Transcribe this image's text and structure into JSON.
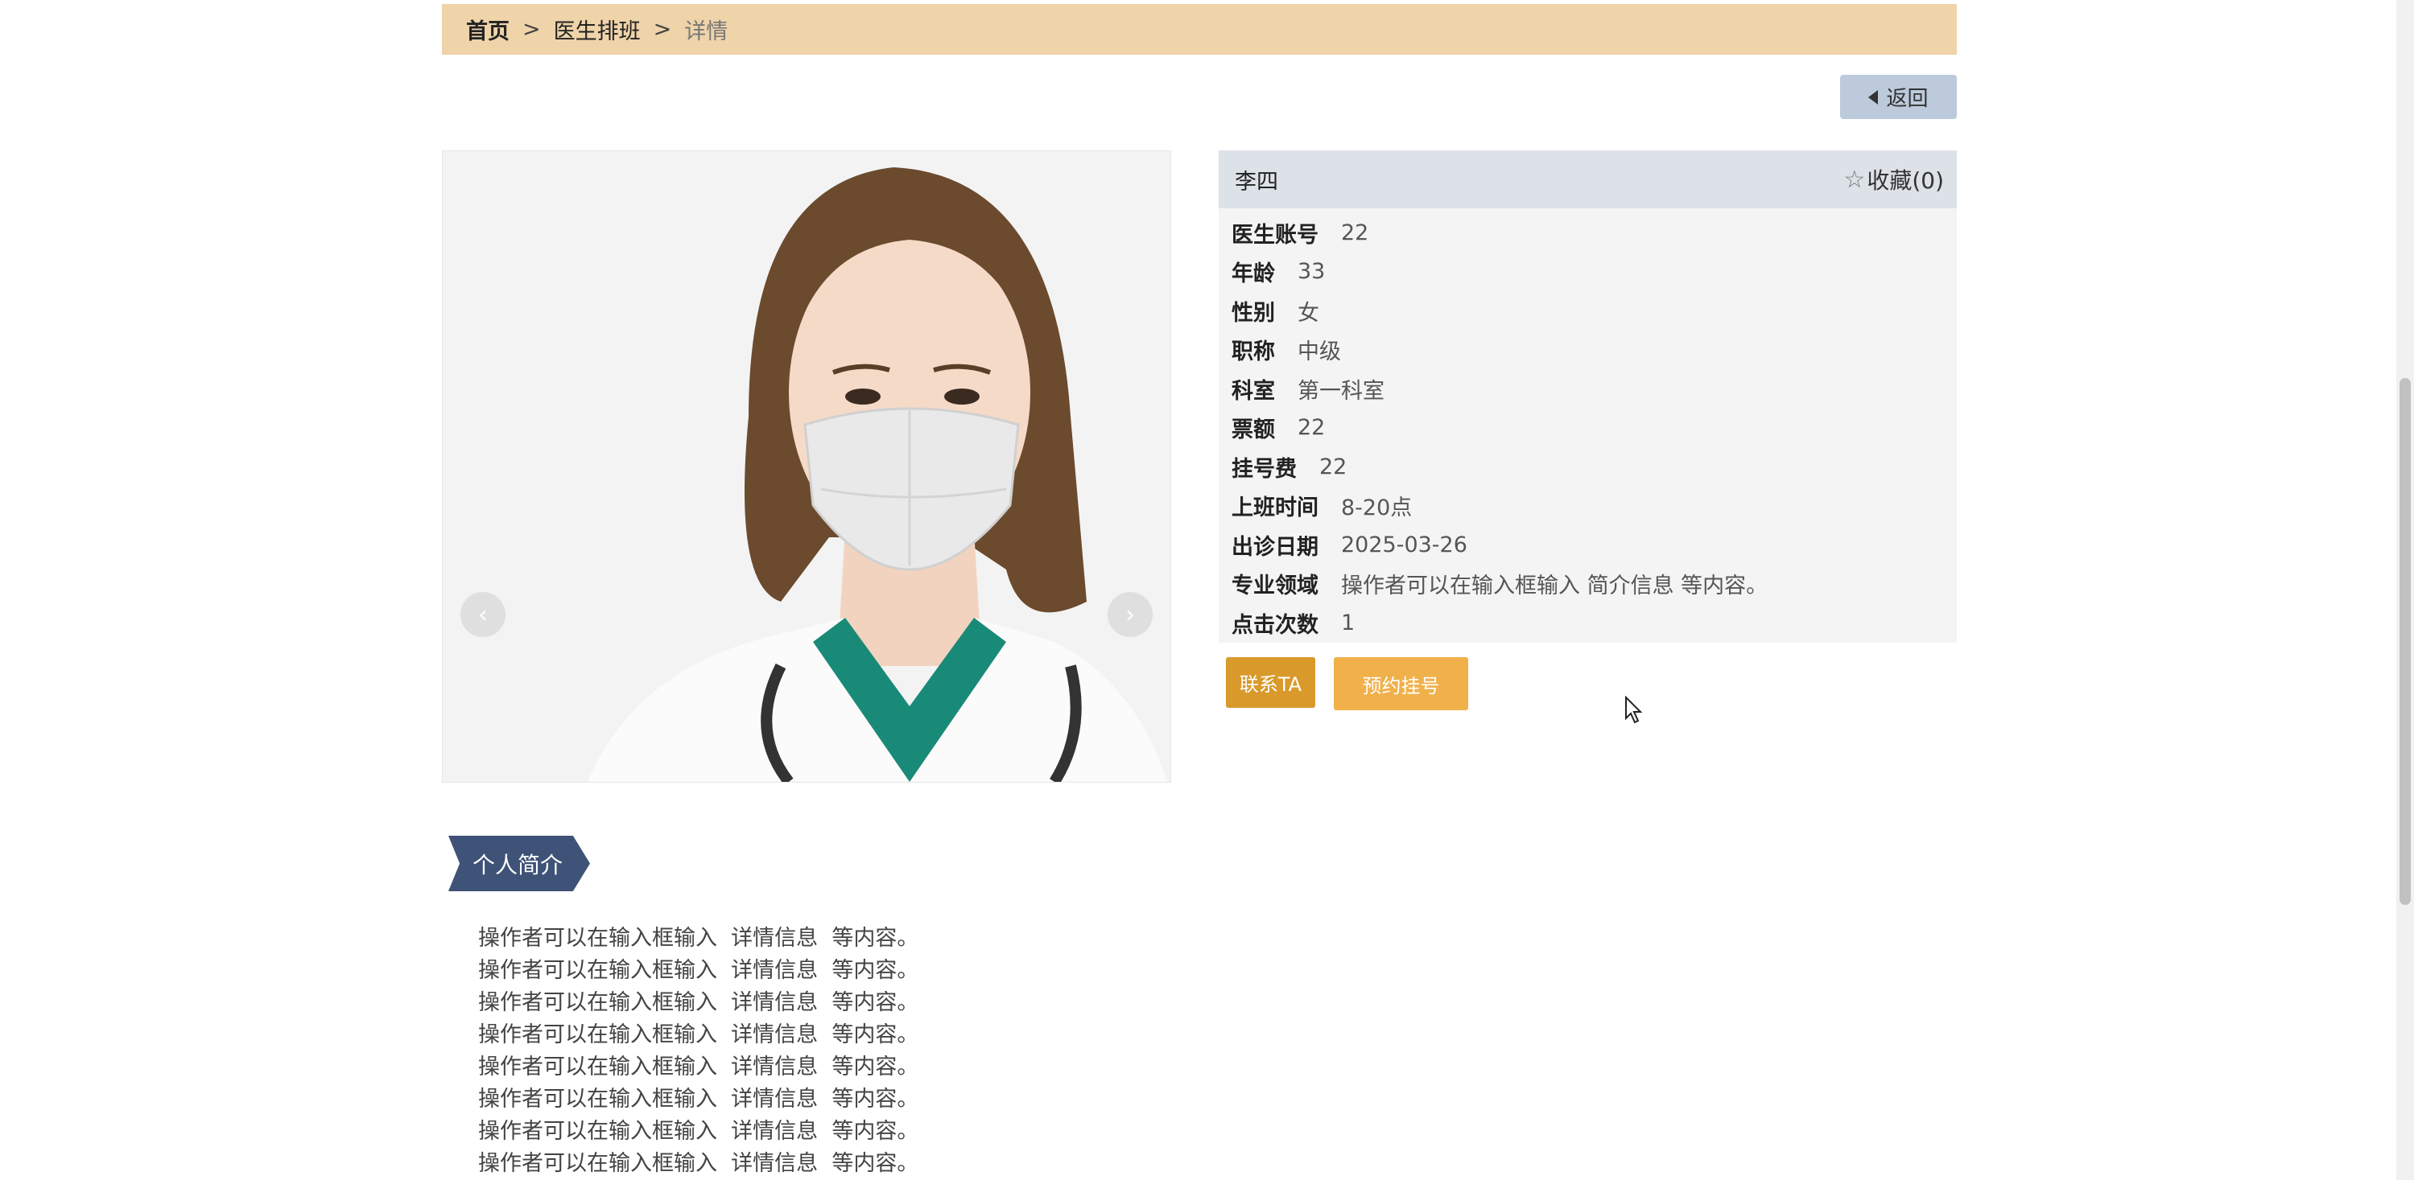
{
  "breadcrumb": {
    "home": "首页",
    "section": "医生排班",
    "current": "详情",
    "separator": ">"
  },
  "back_button": {
    "label": "返回",
    "icon": "caret-left-icon"
  },
  "carousel": {
    "prev_icon": "chevron-left-icon",
    "next_icon": "chevron-right-icon",
    "prev_glyph": "‹",
    "next_glyph": "›"
  },
  "doctor": {
    "name": "李四",
    "favorite": {
      "icon": "star-outline-icon",
      "glyph": "☆",
      "label": "收藏(0)"
    },
    "fields": [
      {
        "label": "医生账号",
        "value": "22"
      },
      {
        "label": "年龄",
        "value": "33"
      },
      {
        "label": "性别",
        "value": "女"
      },
      {
        "label": "职称",
        "value": "中级"
      },
      {
        "label": "科室",
        "value": "第一科室"
      },
      {
        "label": "票额",
        "value": "22"
      },
      {
        "label": "挂号费",
        "value": "22"
      },
      {
        "label": "上班时间",
        "value": "8-20点"
      },
      {
        "label": "出诊日期",
        "value": "2025-03-26"
      },
      {
        "label": "专业领域",
        "value": "操作者可以在输入框输入 简介信息 等内容。"
      },
      {
        "label": "点击次数",
        "value": "1"
      }
    ]
  },
  "actions": {
    "contact": "联系TA",
    "book": "预约挂号"
  },
  "intro": {
    "title": "个人简介",
    "lines": [
      "操作者可以在输入框输入  详情信息  等内容。",
      "操作者可以在输入框输入  详情信息  等内容。",
      "操作者可以在输入框输入  详情信息  等内容。",
      "操作者可以在输入框输入  详情信息  等内容。",
      "操作者可以在输入框输入  详情信息  等内容。",
      "操作者可以在输入框输入  详情信息  等内容。",
      "操作者可以在输入框输入  详情信息  等内容。",
      "操作者可以在输入框输入  详情信息  等内容。"
    ]
  },
  "colors": {
    "breadcrumb_bg": "#efd3a9",
    "back_bg": "#bccadb",
    "contact_bg": "#d99a2b",
    "book_bg": "#f0b14b",
    "tag_bg": "#3f5277"
  }
}
